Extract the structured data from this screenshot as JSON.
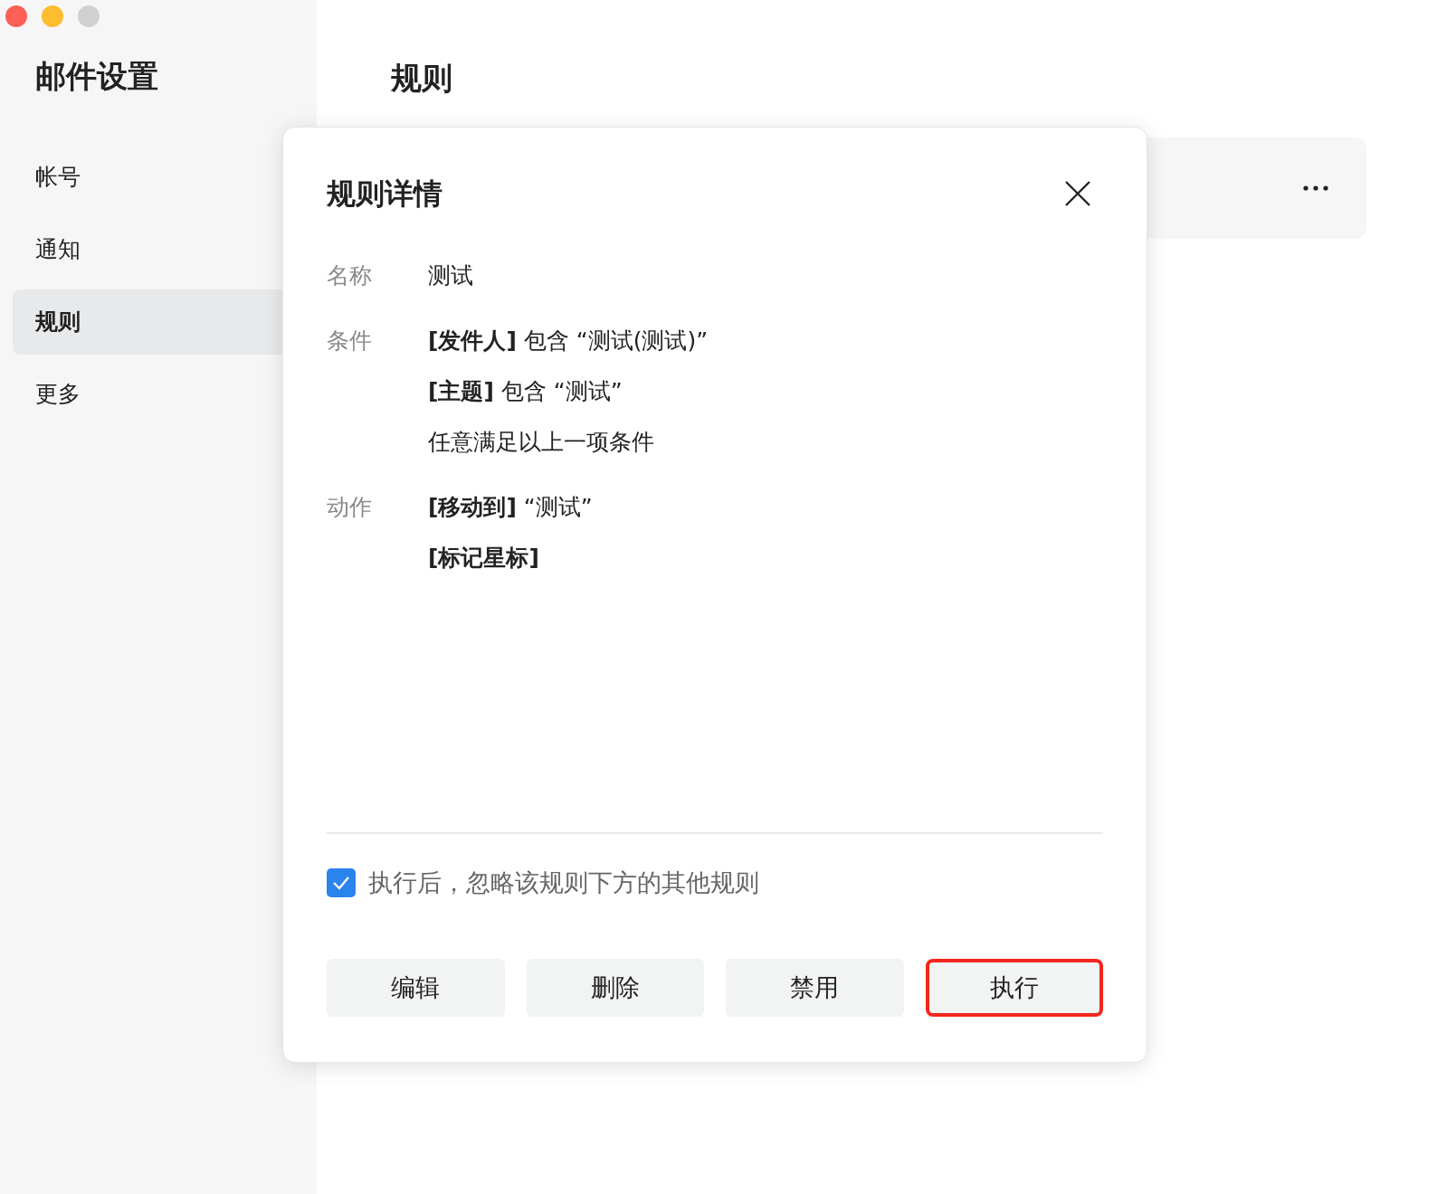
{
  "window": {
    "controls": [
      {
        "color": "#fe5f57"
      },
      {
        "color": "#febc2e"
      },
      {
        "color": "#d0d0d0"
      }
    ]
  },
  "sidebar": {
    "title": "邮件设置",
    "items": [
      {
        "label": "帐号",
        "selected": false
      },
      {
        "label": "通知",
        "selected": false
      },
      {
        "label": "规则",
        "selected": true
      },
      {
        "label": "更多",
        "selected": false
      }
    ]
  },
  "main": {
    "title": "规则"
  },
  "dialog": {
    "title": "规则详情",
    "rows": [
      {
        "label": "名称",
        "lines": [
          "测试"
        ]
      },
      {
        "label": "条件",
        "lines": [
          "**[发件人]** 包含 “测试(测试)”",
          "**[主题]** 包含 “测试”",
          "任意满足以上一项条件"
        ]
      },
      {
        "label": "动作",
        "lines": [
          "**[移动到]** “测试”",
          "**[标记星标]**"
        ]
      }
    ],
    "option": {
      "label": "执行后，忽略该规则下方的其他规则",
      "checked": true
    },
    "buttons": [
      {
        "label": "编辑",
        "highlighted": false
      },
      {
        "label": "删除",
        "highlighted": false
      },
      {
        "label": "禁用",
        "highlighted": false
      },
      {
        "label": "执行",
        "highlighted": true
      }
    ]
  }
}
